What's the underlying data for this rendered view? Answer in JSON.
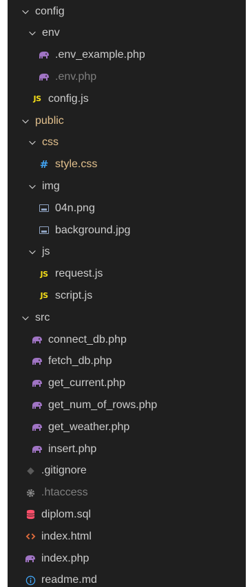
{
  "colors": {
    "background": "#1f1f1f",
    "text": "#cccccc",
    "git_modified": "#e2c08d",
    "ignored": "#7f7f7f",
    "php": "#a074c4",
    "js": "#f5de19",
    "css": "#42a5f5",
    "sql": "#ff4f6a",
    "html": "#e06c3c",
    "info": "#42a5f5"
  },
  "tree": [
    {
      "label": "config",
      "type": "folder",
      "expanded": true,
      "depth": 0
    },
    {
      "label": "env",
      "type": "folder",
      "expanded": true,
      "depth": 1
    },
    {
      "label": ".env_example.php",
      "type": "file",
      "icon": "php-elephant-icon",
      "depth": 2
    },
    {
      "label": ".env.php",
      "type": "file",
      "icon": "php-elephant-icon",
      "depth": 2,
      "ignored": true
    },
    {
      "label": "config.js",
      "type": "file",
      "icon": "js-icon",
      "depth": 1
    },
    {
      "label": "public",
      "type": "folder",
      "expanded": true,
      "depth": 0,
      "modified": true
    },
    {
      "label": "css",
      "type": "folder",
      "expanded": true,
      "depth": 1,
      "modified": true
    },
    {
      "label": "style.css",
      "type": "file",
      "icon": "css-hash-icon",
      "depth": 2,
      "modified": true
    },
    {
      "label": "img",
      "type": "folder",
      "expanded": true,
      "depth": 1
    },
    {
      "label": "04n.png",
      "type": "file",
      "icon": "image-icon",
      "depth": 2
    },
    {
      "label": "background.jpg",
      "type": "file",
      "icon": "image-icon",
      "depth": 2
    },
    {
      "label": "js",
      "type": "folder",
      "expanded": true,
      "depth": 1
    },
    {
      "label": "request.js",
      "type": "file",
      "icon": "js-icon",
      "depth": 2
    },
    {
      "label": "script.js",
      "type": "file",
      "icon": "js-icon",
      "depth": 2
    },
    {
      "label": "src",
      "type": "folder",
      "expanded": true,
      "depth": 0
    },
    {
      "label": "connect_db.php",
      "type": "file",
      "icon": "php-elephant-icon",
      "depth": 1
    },
    {
      "label": "fetch_db.php",
      "type": "file",
      "icon": "php-elephant-icon",
      "depth": 1
    },
    {
      "label": "get_current.php",
      "type": "file",
      "icon": "php-elephant-icon",
      "depth": 1
    },
    {
      "label": "get_num_of_rows.php",
      "type": "file",
      "icon": "php-elephant-icon",
      "depth": 1
    },
    {
      "label": "get_weather.php",
      "type": "file",
      "icon": "php-elephant-icon",
      "depth": 1
    },
    {
      "label": "insert.php",
      "type": "file",
      "icon": "php-elephant-icon",
      "depth": 1
    },
    {
      "label": ".gitignore",
      "type": "file",
      "icon": "git-diamond-icon",
      "depth": 0
    },
    {
      "label": ".htaccess",
      "type": "file",
      "icon": "gear-icon",
      "depth": 0,
      "ignored": true
    },
    {
      "label": "diplom.sql",
      "type": "file",
      "icon": "database-icon",
      "depth": 0
    },
    {
      "label": "index.html",
      "type": "file",
      "icon": "html-brackets-icon",
      "depth": 0
    },
    {
      "label": "index.php",
      "type": "file",
      "icon": "php-elephant-icon",
      "depth": 0
    },
    {
      "label": "readme.md",
      "type": "file",
      "icon": "info-icon",
      "depth": 0
    }
  ]
}
